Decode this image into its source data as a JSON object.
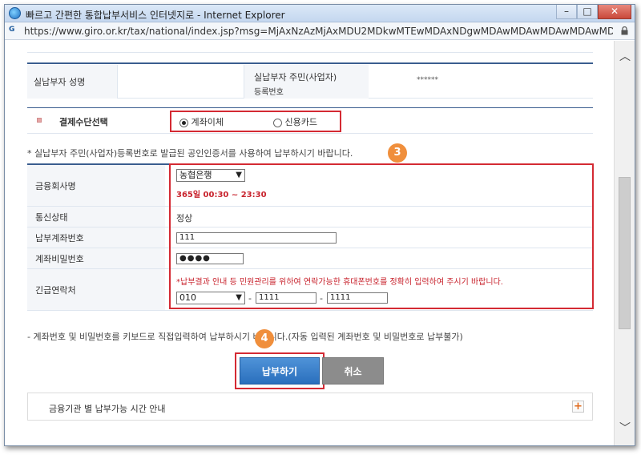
{
  "window": {
    "title": "빠르고 간편한 통합납부서비스 인터넷지로 - Internet Explorer",
    "url": "https://www.giro.or.kr/tax/national/index.jsp?msg=MjAxNzAzMjAxMDU2MDkwMTEwMDAxNDgwMDAwMDAwMDAwMDAwMDAwMDAwMGdh"
  },
  "payer": {
    "name_label": "실납부자 성명",
    "name_value": "",
    "id_label_line1": "실납부자 주민(사업자)",
    "id_label_line2": "등록번호",
    "id_value": "******"
  },
  "payment_method": {
    "label": "결제수단선택",
    "options": [
      "계좌이체",
      "신용카드"
    ],
    "selected": "계좌이체"
  },
  "notes": {
    "certificate": "* 실납부자 주민(사업자)등록번호로 발급된 공인인증서를 사용하여 납부하시기 바랍니다.",
    "keyboard": "- 계좌번호 및 비밀번호를 키보드로 직접입력하여 납부하시기 바랍니다.(자동 입력된 계좌번호 및 비밀번호로 납부불가)"
  },
  "form": {
    "bank_label": "금융회사명",
    "bank_selected": "농협은행",
    "bank_hours": "365일 00:30 ~ 23:30",
    "comm_label": "통신상태",
    "comm_value": "정상",
    "account_label": "납부계좌번호",
    "account_value": "111",
    "password_label": "계좌비밀번호",
    "password_value": "●●●●",
    "contact_label": "긴급연락처",
    "contact_notice": "*납부결과 안내 등 민원관리를 위하여 연락가능한 휴대폰번호를 정확히 입력하여 주시기 바랍니다.",
    "phone_prefix": "010",
    "phone_mid": "1111",
    "phone_last": "1111",
    "dash": "-"
  },
  "steps": {
    "step3": "3",
    "step4": "4"
  },
  "buttons": {
    "pay": "납부하기",
    "cancel": "취소"
  },
  "info": {
    "hours_guide": "금융기관 별 납부가능 시간 안내",
    "expand": "+"
  },
  "colors": {
    "highlight_red": "#d42a33",
    "primary_blue": "#2a6fbd",
    "step_orange": "#f08f3c",
    "warning_red": "#c8232d"
  }
}
